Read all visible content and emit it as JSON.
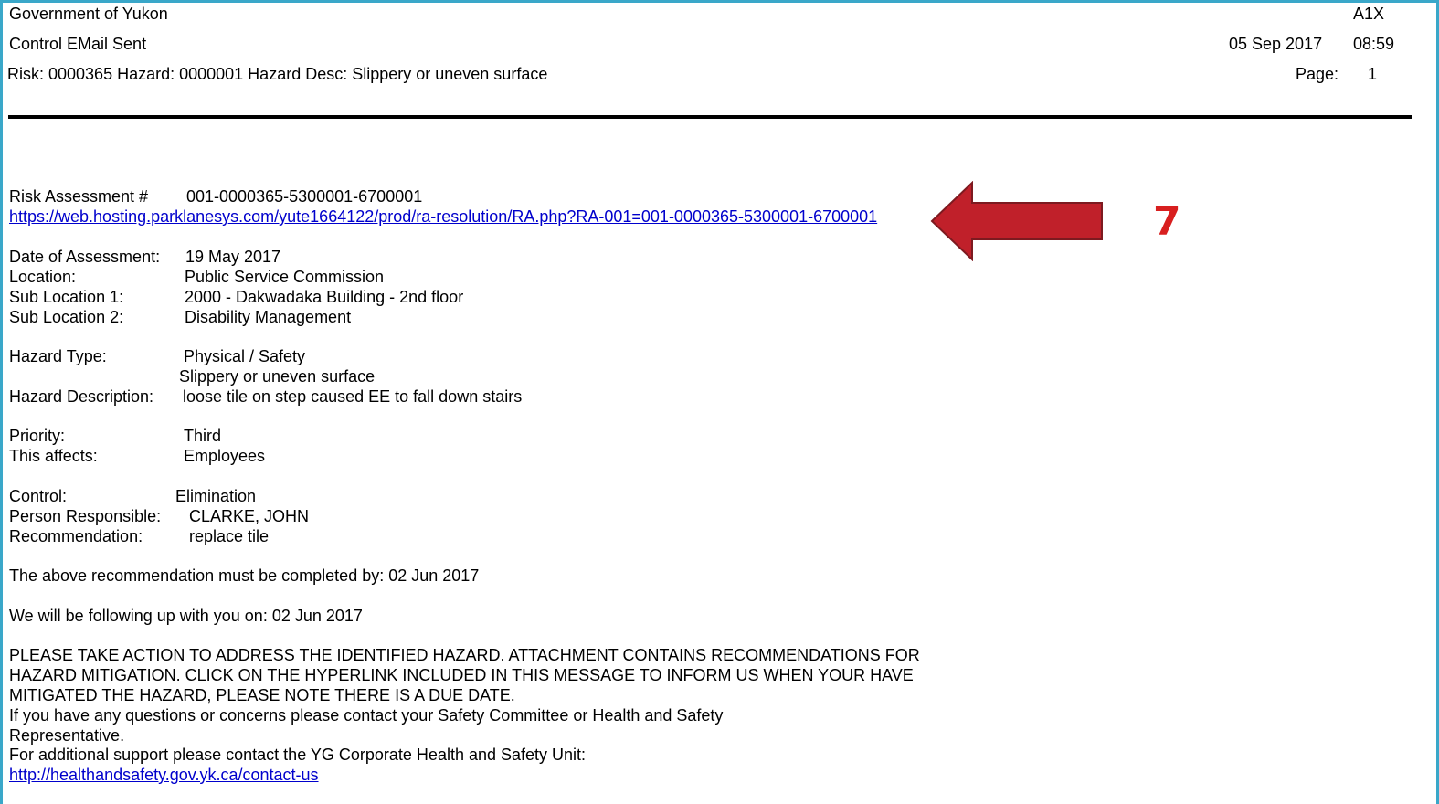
{
  "header": {
    "org": "Government of Yukon",
    "code": "A1X",
    "report_title": "Control EMail Sent",
    "date": "05 Sep 2017",
    "time": "08:59",
    "risk_line": "Risk: 0000365 Hazard: 0000001 Hazard Desc: Slippery or uneven surface",
    "page_label": "Page:",
    "page_number": "1"
  },
  "assessment": {
    "label": "Risk Assessment #",
    "number": "001-0000365-5300001-6700001",
    "url": "https://web.hosting.parklanesys.com/yute1664122/prod/ra-resolution/RA.php?RA-001=001-0000365-5300001-6700001"
  },
  "callout": {
    "number": "7",
    "arrow_color": "#c0202a",
    "number_color": "#d81f1f"
  },
  "details": {
    "date_label": "Date of Assessment:",
    "date_value": "19 May 2017",
    "location_label": "Location:",
    "location_value": "Public Service Commission",
    "sub1_label": "Sub Location 1:",
    "sub1_value": "2000 - Dakwadaka Building - 2nd floor",
    "sub2_label": "Sub Location 2:",
    "sub2_value": "Disability Management",
    "hazard_type_label": "Hazard Type:",
    "hazard_type_value": "Physical / Safety",
    "hazard_subtype_value": "Slippery or uneven surface",
    "hazard_desc_label": "Hazard Description:",
    "hazard_desc_value": "loose tile on step caused EE to fall down stairs",
    "priority_label": "Priority:",
    "priority_value": "Third",
    "affects_label": "This affects:",
    "affects_value": "Employees",
    "control_label": "Control:",
    "control_value": "Elimination",
    "person_label": "Person Responsible:",
    "person_value": "CLARKE, JOHN",
    "recommendation_label": "Recommendation:",
    "recommendation_value": "replace tile"
  },
  "body": {
    "completed_by": "The above recommendation must be completed by: 02 Jun 2017",
    "follow_up": "We will be following up with you on: 02 Jun 2017",
    "action_line1": "PLEASE TAKE ACTION TO ADDRESS THE IDENTIFIED HAZARD.  ATTACHMENT CONTAINS RECOMMENDATIONS FOR",
    "action_line2": "HAZARD MITIGATION. CLICK ON THE HYPERLINK INCLUDED IN THIS MESSAGE TO INFORM US WHEN YOUR HAVE",
    "action_line3": "MITIGATED THE HAZARD, PLEASE NOTE THERE IS A DUE DATE.",
    "questions_line1": "If you have any questions or concerns please contact your Safety Committee or Health and Safety",
    "questions_line2": "Representative.",
    "support_line": "For additional support please contact the YG Corporate Health and Safety Unit:",
    "support_url": "http://healthandsafety.gov.yk.ca/contact-us"
  }
}
